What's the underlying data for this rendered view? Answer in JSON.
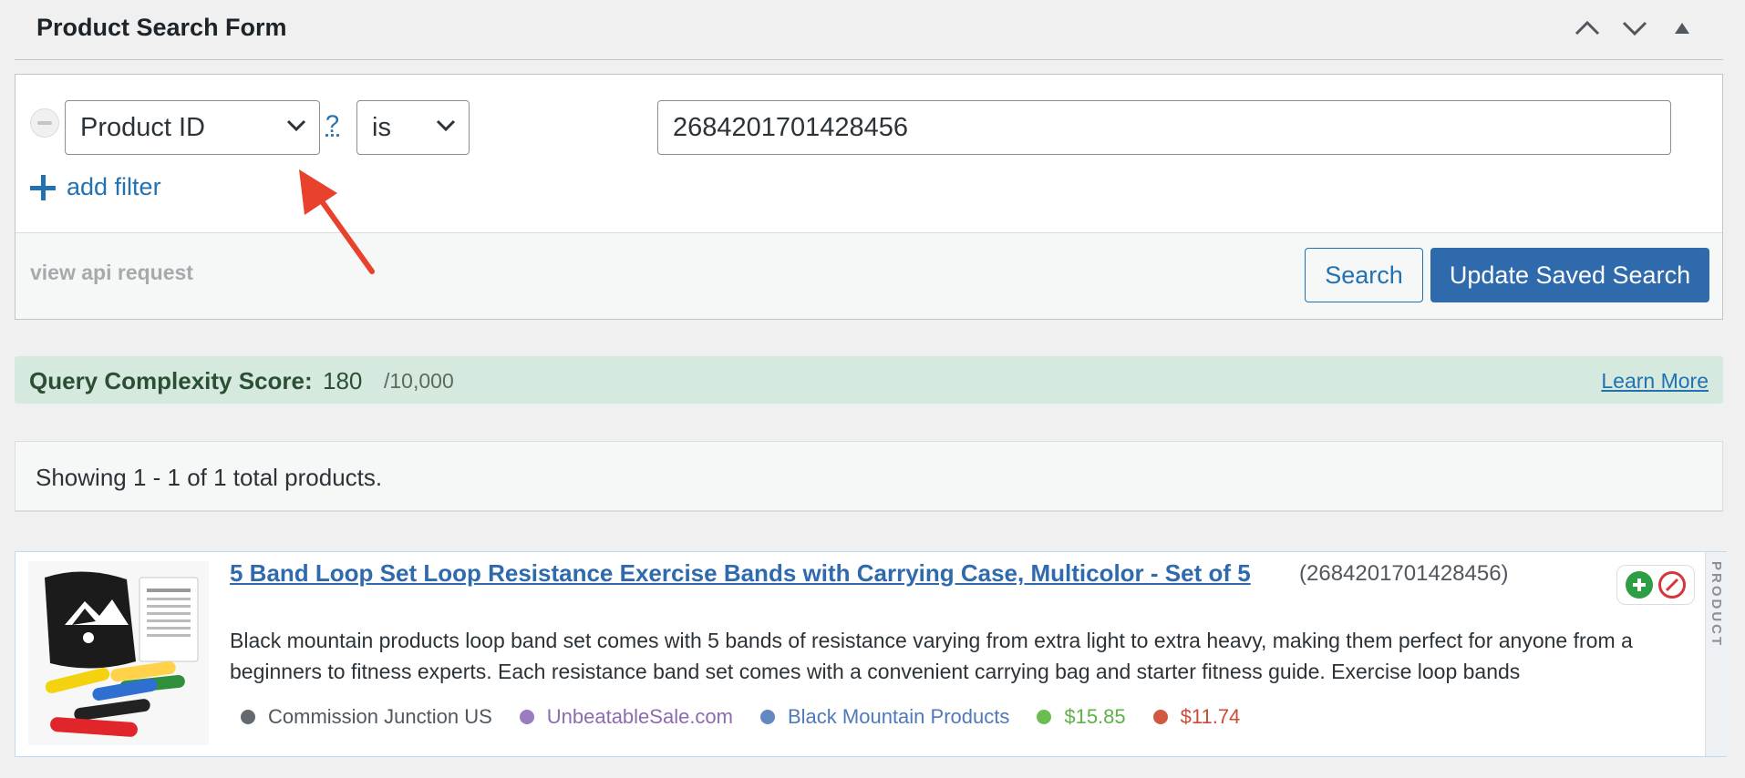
{
  "panel": {
    "title": "Product Search Form"
  },
  "filter": {
    "field_value": "Product ID",
    "help_label": "?",
    "operator_value": "is",
    "input_value": "2684201701428456",
    "add_filter_label": "add filter"
  },
  "footer": {
    "api_link": "view api request",
    "search_label": "Search",
    "update_label": "Update Saved Search"
  },
  "complexity": {
    "label": "Query Complexity Score:",
    "score": "180",
    "max": "/10,000",
    "learn_more": "Learn More"
  },
  "results": {
    "summary": "Showing 1 - 1 of 1 total products."
  },
  "product": {
    "title": "5 Band Loop Set Loop Resistance Exercise Bands with Carrying Case, Multicolor - Set of 5",
    "id": "(2684201701428456)",
    "side_tab": "PRODUCT",
    "description": "Black mountain products loop band set comes with 5 bands of resistance varying from extra light to extra heavy, making them perfect for anyone from a beginners to fitness experts. Each resistance band set comes with a convenient carrying bag and starter fitness guide. Exercise loop bands",
    "network": "Commission Junction US",
    "merchant": "UnbeatableSale.com",
    "brand": "Black Mountain Products",
    "price": "$15.85",
    "sale_price": "$11.74"
  },
  "colors": {
    "accent": "#2271b1",
    "primary_button": "#2f6aad",
    "complexity_bg": "#d5e9df",
    "network": "#646970",
    "merchant": "#8c6bb1",
    "brand": "#4f79b8",
    "price": "#5fb146",
    "sale_price": "#cc4b37"
  },
  "icons": [
    "chevron-up-icon",
    "chevron-down-icon",
    "collapse-triangle-icon",
    "remove-filter-icon",
    "select-chevron-icon",
    "plus-icon",
    "add-product-icon",
    "block-product-icon",
    "annotation-arrow"
  ]
}
